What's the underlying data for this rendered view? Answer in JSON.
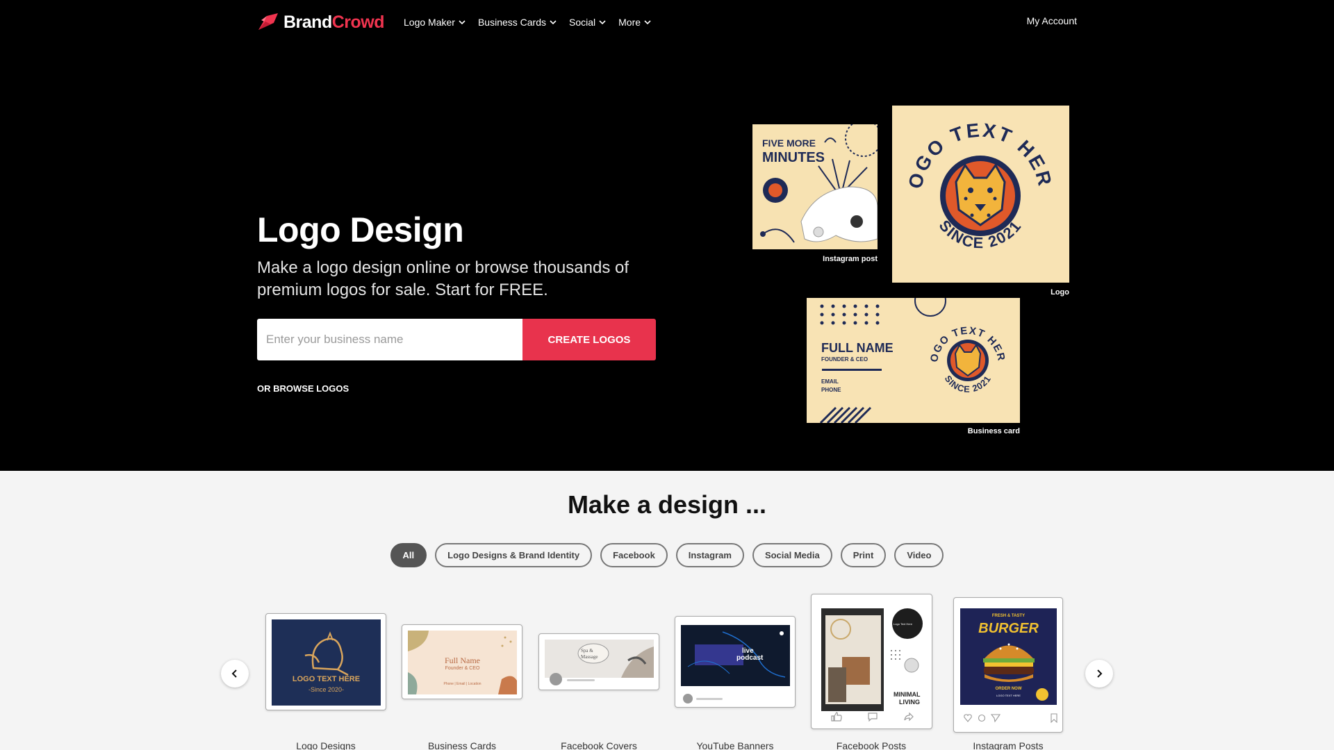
{
  "nav": {
    "brand_part1": "Brand",
    "brand_part2": "Crowd",
    "items": [
      {
        "label": "Logo Maker"
      },
      {
        "label": "Business Cards"
      },
      {
        "label": "Social"
      },
      {
        "label": "More"
      }
    ],
    "account": "My Account"
  },
  "hero": {
    "title": "Logo Design",
    "subtitle": "Make a logo design online or browse thousands of premium logos for sale. Start for FREE.",
    "search_placeholder": "Enter your business name",
    "cta": "CREATE LOGOS",
    "browse": "OR BROWSE LOGOS"
  },
  "mockups": {
    "instagram": {
      "caption": "Instagram post",
      "headline_1": "FIVE MORE",
      "headline_2": "MINUTES"
    },
    "logo": {
      "caption": "Logo",
      "ring_text": "LOGO TEXT HERE",
      "since_text": "SINCE 2021"
    },
    "business_card": {
      "caption": "Business card",
      "name": "FULL NAME",
      "role": "FOUNDER & CEO",
      "email": "EMAIL",
      "phone": "PHONE"
    }
  },
  "section": {
    "title": "Make a design ...",
    "chips": [
      {
        "label": "All",
        "active": true
      },
      {
        "label": "Logo Designs & Brand Identity"
      },
      {
        "label": "Facebook"
      },
      {
        "label": "Instagram"
      },
      {
        "label": "Social Media"
      },
      {
        "label": "Print"
      },
      {
        "label": "Video"
      }
    ]
  },
  "cards": [
    {
      "label": "Logo Designs",
      "text_1": "LOGO TEXT HERE",
      "text_2": "-Since 2020-"
    },
    {
      "label": "Business Cards",
      "text_1": "Full Name",
      "text_2": "Founder & CEO",
      "text_3": "Phone | Email | Location"
    },
    {
      "label": "Facebook Covers",
      "text_1": "Spa &",
      "text_2": "Massage"
    },
    {
      "label": "YouTube Banners",
      "text_1": "live",
      "text_2": "podcast"
    },
    {
      "label": "Facebook Posts",
      "text_1": "MINIMAL",
      "text_2": "LIVING",
      "text_3": "Logo Text Here"
    },
    {
      "label": "Instagram Posts",
      "text_1": "FRESH & TASTY",
      "text_2": "BURGER",
      "text_3": "ORDER NOW",
      "text_4": "LOGO TEXT HERE"
    }
  ],
  "colors": {
    "accent": "#e8334d",
    "hero_bg": "#000000",
    "section_bg": "#f4f4f4",
    "navy": "#1e2a56",
    "cream": "#f8e3b4"
  }
}
